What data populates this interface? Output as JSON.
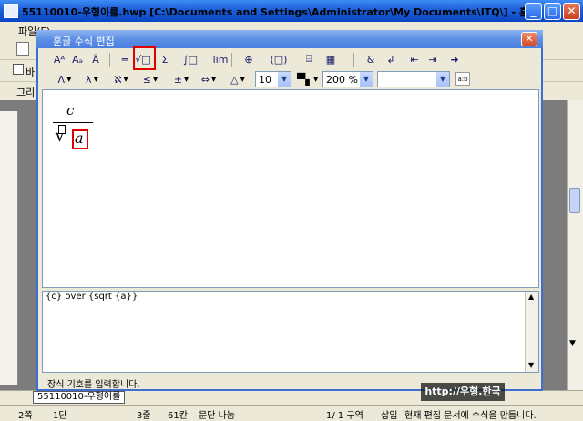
{
  "app": {
    "title": "55110010-우형이를.hwp [C:\\Documents and Settings\\Administrator\\My Documents\\ITQ\\] - 훈글",
    "menu_label": "파일(F)",
    "toolbar2_label": "바탕",
    "toolbar3_label": "그리기",
    "doc_tab": "55110010-우형이를"
  },
  "status_bar": {
    "page": "2쪽",
    "section": "1단",
    "line": "3줄",
    "column": "61칸",
    "mode": "문단 나눔",
    "page_count": "1/  1 구역",
    "insert": "삽입",
    "message": "현재 편집 문서에 수식을 만듭니다."
  },
  "dialog": {
    "title": "훈글 수식 편집",
    "toolbar1": {
      "buttons": [
        {
          "icon": "Aᴬ",
          "name": "superscript-icon"
        },
        {
          "icon": "Aₐ",
          "name": "subscript-icon"
        },
        {
          "icon": "Ä",
          "name": "decoration-icon"
        },
        {
          "icon": "═",
          "name": "fraction-icon"
        },
        {
          "icon": "√□",
          "name": "sqrt-icon"
        },
        {
          "icon": "Σ",
          "name": "sum-icon"
        },
        {
          "icon": "∫□",
          "name": "integral-icon"
        },
        {
          "icon": "lim",
          "name": "limit-icon"
        },
        {
          "icon": "⊕",
          "name": "matrix-icon"
        },
        {
          "icon": "(□)",
          "name": "bracket-icon"
        },
        {
          "icon": "⌸",
          "name": "case-icon"
        },
        {
          "icon": "▦",
          "name": "grid-icon"
        },
        {
          "icon": "&",
          "name": "ampersand-icon"
        },
        {
          "icon": "↲",
          "name": "newline-icon"
        },
        {
          "icon": "⇤",
          "name": "align-left-icon"
        },
        {
          "icon": "⇥",
          "name": "align-right-icon"
        },
        {
          "icon": "➜",
          "name": "insert-equation-icon"
        }
      ]
    },
    "toolbar2": {
      "buttons": [
        {
          "icon": "Λ",
          "name": "greek-upper-icon"
        },
        {
          "icon": "λ",
          "name": "greek-lower-icon"
        },
        {
          "icon": "ℵ",
          "name": "symbol-icon"
        },
        {
          "icon": "≤",
          "name": "relation-icon"
        },
        {
          "icon": "±",
          "name": "operator-icon"
        },
        {
          "icon": "⇔",
          "name": "arrow-icon"
        },
        {
          "icon": "△",
          "name": "misc-icon"
        }
      ],
      "font_size": "10",
      "zoom": "200 %",
      "font_name": ""
    },
    "equation_script": "{c} over {sqrt {a}}",
    "equation": {
      "numerator": "c",
      "denominator": "a"
    },
    "status": "장식 기호를 입력합니다."
  },
  "watermark": "http://우형.한국",
  "colors": {
    "highlight": "#e00000",
    "titlebar": "#1d5fd6"
  }
}
